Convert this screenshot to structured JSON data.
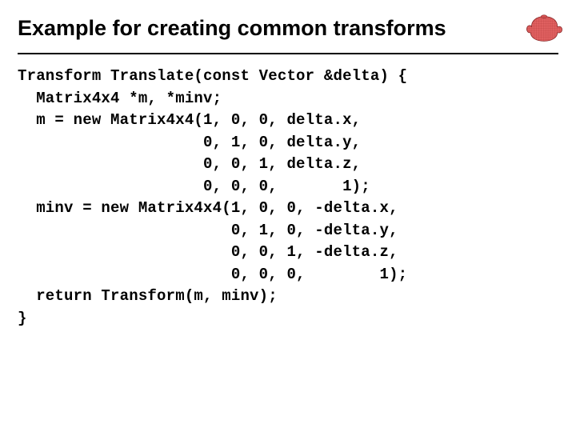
{
  "title": "Example for creating common transforms",
  "code": "Transform Translate(const Vector &delta) {\n  Matrix4x4 *m, *minv;\n  m = new Matrix4x4(1, 0, 0, delta.x,\n                    0, 1, 0, delta.y,\n                    0, 0, 1, delta.z,\n                    0, 0, 0,       1);\n  minv = new Matrix4x4(1, 0, 0, -delta.x,\n                       0, 1, 0, -delta.y,\n                       0, 0, 1, -delta.z,\n                       0, 0, 0,        1);\n  return Transform(m, minv);\n}"
}
